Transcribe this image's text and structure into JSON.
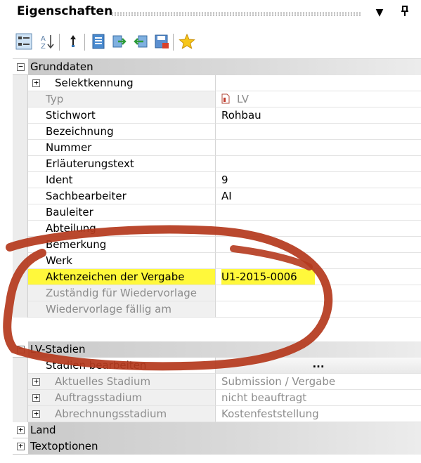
{
  "panel": {
    "title": "Eigenschaften",
    "dropdown_icon": "▼",
    "pin_icon": "ᛘ"
  },
  "toolbar": {
    "tools": [
      {
        "name": "categorized-view-icon"
      },
      {
        "name": "alphabetical-sort-icon"
      },
      {
        "name": "property-pages-icon"
      },
      {
        "name": "document-icon"
      },
      {
        "name": "export-icon"
      },
      {
        "name": "import-icon"
      },
      {
        "name": "save-icon"
      },
      {
        "name": "favorites-star-icon"
      }
    ]
  },
  "grid": {
    "grundleistung": {
      "label": "Grunddaten",
      "expander": "−",
      "selektkennung": {
        "label": "Selektkennung",
        "expander": "+"
      },
      "rows": [
        {
          "name": "Typ",
          "value": "LV"
        },
        {
          "name": "Stichwort",
          "value": "Rohbau"
        },
        {
          "name": "Bezeichnung",
          "value": ""
        },
        {
          "name": "Nummer",
          "value": ""
        },
        {
          "name": "Erläuterungstext",
          "value": ""
        },
        {
          "name": "Ident",
          "value": "9"
        },
        {
          "name": "Sachbearbeiter",
          "value": "AI"
        },
        {
          "name": "Bauleiter",
          "value": ""
        },
        {
          "name": "Abteilung",
          "value": ""
        },
        {
          "name": "Bemerkung",
          "value": ""
        },
        {
          "name": "Werk",
          "value": ""
        },
        {
          "name": "Aktenzeichen der Vergabe",
          "value": "U1-2015-0006"
        },
        {
          "name": "Zuständig für Wiedervorlage",
          "value": ""
        },
        {
          "name": "Wiedervorlage fällig am",
          "value": ""
        }
      ]
    },
    "lv_stadien": {
      "label": "LV-Stadien",
      "expander": "−",
      "edit_row": {
        "name": "Stadien bearbeiten",
        "button": "..."
      },
      "rows": [
        {
          "name": "Aktuelles Stadium",
          "value": "Submission / Vergabe",
          "expander": "+"
        },
        {
          "name": "Auftragsstadium",
          "value": "nicht beauftragt",
          "expander": "+"
        },
        {
          "name": "Abrechnungsstadium",
          "value": "Kostenfeststellung",
          "expander": "+"
        }
      ]
    },
    "land": {
      "label": "Land",
      "expander": "+"
    },
    "textoptionen": {
      "label": "Textoptionen",
      "expander": "+"
    }
  },
  "colors": {
    "highlight": "#fff83b",
    "annotation": "#b53a1e"
  }
}
